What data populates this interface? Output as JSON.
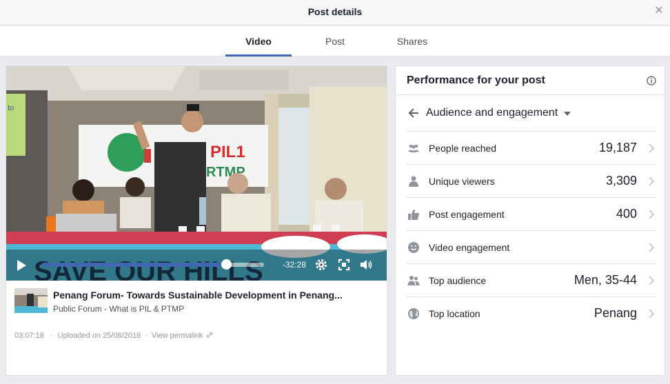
{
  "modal": {
    "title": "Post details",
    "close_icon": "close-icon"
  },
  "tabs": [
    {
      "label": "Video",
      "active": true
    },
    {
      "label": "Post",
      "active": false
    },
    {
      "label": "Shares",
      "active": false
    }
  ],
  "player": {
    "time_remaining": "-32:28",
    "progress": 0.83,
    "accent": "#4267b2",
    "icons": [
      "play-icon",
      "gear-icon",
      "fullscreen-icon",
      "volume-icon"
    ],
    "video_text": {
      "slide_fragment": "to",
      "banner_left": "PIL1",
      "banner_right": "RTMP",
      "table_banner": "SAVE OUR HILLS"
    }
  },
  "video_info": {
    "title": "Penang Forum- Towards Sustainable Development in Penang...",
    "subtitle": "Public Forum - What is PIL & PTMP",
    "duration": "03:07:18",
    "separator": "·",
    "uploaded": "Uploaded on 25/08/2018",
    "separator2": "·",
    "permalink": "View permalink"
  },
  "performance": {
    "title": "Performance for your post",
    "dropdown_label": "Audience and engagement",
    "metrics": [
      {
        "icon": "people-icon",
        "label": "People reached",
        "value": "19,187"
      },
      {
        "icon": "person-icon",
        "label": "Unique viewers",
        "value": "3,309"
      },
      {
        "icon": "thumbs-up-icon",
        "label": "Post engagement",
        "value": "400"
      },
      {
        "icon": "smiley-icon",
        "label": "Video engagement",
        "value": ""
      },
      {
        "icon": "people-icon",
        "label": "Top audience",
        "value": "Men, 35-44"
      },
      {
        "icon": "globe-icon",
        "label": "Top location",
        "value": "Penang"
      }
    ]
  }
}
